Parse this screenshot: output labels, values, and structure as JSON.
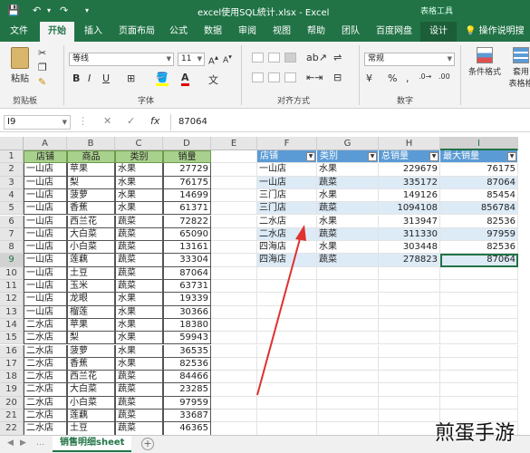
{
  "titlebar": {
    "title": "excel使用SQL統计.xlsx  -  Excel",
    "context_tool": "表格工具",
    "save_icon": "save-icon",
    "undo_icon": "undo-icon",
    "redo_icon": "redo-icon"
  },
  "tabs": [
    {
      "label": "文件"
    },
    {
      "label": "开始"
    },
    {
      "label": "插入"
    },
    {
      "label": "页面布局"
    },
    {
      "label": "公式"
    },
    {
      "label": "数据"
    },
    {
      "label": "审阅"
    },
    {
      "label": "视图"
    },
    {
      "label": "帮助"
    },
    {
      "label": "团队"
    },
    {
      "label": "百度网盘"
    },
    {
      "label": "设计"
    }
  ],
  "search_tip": "操作说明搜索",
  "ribbon": {
    "paste_label": "粘贴",
    "clipboard_label": "剪贴板",
    "font_name": "等线",
    "font_size": "11",
    "bold": "B",
    "italic": "I",
    "underline": "U",
    "font_label": "字体",
    "align_label": "对齐方式",
    "number_format": "常规",
    "number_label": "数字",
    "cond_format_label": "条件格式",
    "table_label_1": "套用",
    "table_label_2": "表格格"
  },
  "formula_bar": {
    "name_box": "I9",
    "cancel": "✕",
    "enter": "✓",
    "fx": "fx",
    "value": "87064"
  },
  "columns": [
    "A",
    "B",
    "C",
    "D",
    "E",
    "F",
    "G",
    "H",
    "I"
  ],
  "rows": [
    "1",
    "2",
    "3",
    "4",
    "5",
    "6",
    "7",
    "8",
    "9",
    "10",
    "11",
    "12",
    "13",
    "14",
    "15",
    "16",
    "17",
    "18",
    "19",
    "20",
    "21",
    "22"
  ],
  "left_table": {
    "headers": [
      "店铺",
      "商品",
      "类别",
      "销量"
    ],
    "rows": [
      [
        "一山店",
        "苹果",
        "水果",
        "27729"
      ],
      [
        "一山店",
        "梨",
        "水果",
        "76175"
      ],
      [
        "一山店",
        "菠萝",
        "水果",
        "14699"
      ],
      [
        "一山店",
        "香蕉",
        "水果",
        "61371"
      ],
      [
        "一山店",
        "西兰花",
        "蔬菜",
        "72822"
      ],
      [
        "一山店",
        "大白菜",
        "蔬菜",
        "65090"
      ],
      [
        "一山店",
        "小白菜",
        "蔬菜",
        "13161"
      ],
      [
        "一山店",
        "莲藕",
        "蔬菜",
        "33304"
      ],
      [
        "一山店",
        "土豆",
        "蔬菜",
        "87064"
      ],
      [
        "一山店",
        "玉米",
        "蔬菜",
        "63731"
      ],
      [
        "一山店",
        "龙眼",
        "水果",
        "19339"
      ],
      [
        "一山店",
        "榴莲",
        "水果",
        "30366"
      ],
      [
        "二水店",
        "苹果",
        "水果",
        "18380"
      ],
      [
        "二水店",
        "梨",
        "水果",
        "59943"
      ],
      [
        "二水店",
        "菠萝",
        "水果",
        "36535"
      ],
      [
        "二水店",
        "香蕉",
        "水果",
        "82536"
      ],
      [
        "二水店",
        "西兰花",
        "蔬菜",
        "84466"
      ],
      [
        "二水店",
        "大白菜",
        "蔬菜",
        "23285"
      ],
      [
        "二水店",
        "小白菜",
        "蔬菜",
        "97959"
      ],
      [
        "二水店",
        "莲藕",
        "蔬菜",
        "33687"
      ],
      [
        "二水店",
        "土豆",
        "蔬菜",
        "46365"
      ]
    ]
  },
  "right_table": {
    "headers": [
      "店铺",
      "类别",
      "总销量",
      "最大销量"
    ],
    "rows": [
      [
        "一山店",
        "水果",
        "229679",
        "76175"
      ],
      [
        "一山店",
        "蔬菜",
        "335172",
        "87064"
      ],
      [
        "三门店",
        "水果",
        "149126",
        "85454"
      ],
      [
        "三门店",
        "蔬菜",
        "1094108",
        "856784"
      ],
      [
        "二水店",
        "水果",
        "313947",
        "82536"
      ],
      [
        "二水店",
        "蔬菜",
        "311330",
        "97959"
      ],
      [
        "四海店",
        "水果",
        "303448",
        "82536"
      ],
      [
        "四海店",
        "蔬菜",
        "278823",
        "87064"
      ]
    ]
  },
  "sheet_tab": "销售明细sheet",
  "add_sheet": "+",
  "watermark": "煎蛋手游",
  "colors": {
    "excel_green": "#217346",
    "table_blue": "#5b9bd5",
    "band_blue": "#ddebf7",
    "header_green": "#a9d18e",
    "arrow_red": "#e03030"
  }
}
